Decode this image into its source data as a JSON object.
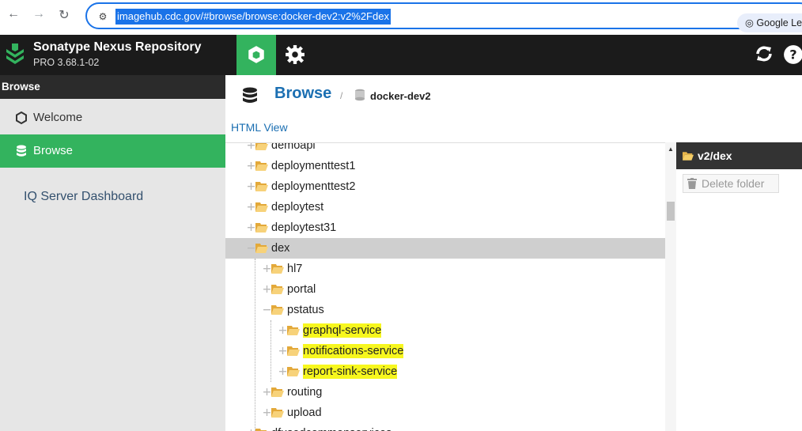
{
  "browser": {
    "url": "imagehub.cdc.gov/#browse/browse:docker-dev2:v2%2Fdex",
    "lens_label": "Google Lens"
  },
  "app": {
    "title": "Sonatype Nexus Repository",
    "version": "PRO 3.68.1-02",
    "accent": "#33b35e",
    "header_bg": "#1b1b1b"
  },
  "sidebar": {
    "heading": "Browse",
    "items": [
      {
        "label": "Welcome",
        "icon": "hexagon-icon"
      },
      {
        "label": "Browse",
        "icon": "database-icon",
        "active": true
      }
    ],
    "iq_link": "IQ Server Dashboard"
  },
  "breadcrumb": {
    "title": "Browse",
    "separator": "/",
    "repo": "docker-dev2"
  },
  "html_view_link": "HTML View",
  "tree": [
    {
      "label": "demoapi",
      "level": 0,
      "expanded": false
    },
    {
      "label": "deploymenttest1",
      "level": 0,
      "expanded": false
    },
    {
      "label": "deploymenttest2",
      "level": 0,
      "expanded": false
    },
    {
      "label": "deploytest",
      "level": 0,
      "expanded": false
    },
    {
      "label": "deploytest31",
      "level": 0,
      "expanded": false
    },
    {
      "label": "dex",
      "level": 0,
      "expanded": true,
      "selected": true
    },
    {
      "label": "hl7",
      "level": 1,
      "expanded": false
    },
    {
      "label": "portal",
      "level": 1,
      "expanded": false
    },
    {
      "label": "pstatus",
      "level": 1,
      "expanded": true
    },
    {
      "label": "graphql-service",
      "level": 2,
      "expanded": false,
      "highlight": true
    },
    {
      "label": "notifications-service",
      "level": 2,
      "expanded": false,
      "highlight": true
    },
    {
      "label": "report-sink-service",
      "level": 2,
      "expanded": false,
      "highlight": true
    },
    {
      "label": "routing",
      "level": 1,
      "expanded": false
    },
    {
      "label": "upload",
      "level": 1,
      "expanded": false
    },
    {
      "label": "dfusedcommonservices",
      "level": 0,
      "expanded": false
    }
  ],
  "detail": {
    "title": "v2/dex",
    "delete_label": "Delete folder"
  }
}
